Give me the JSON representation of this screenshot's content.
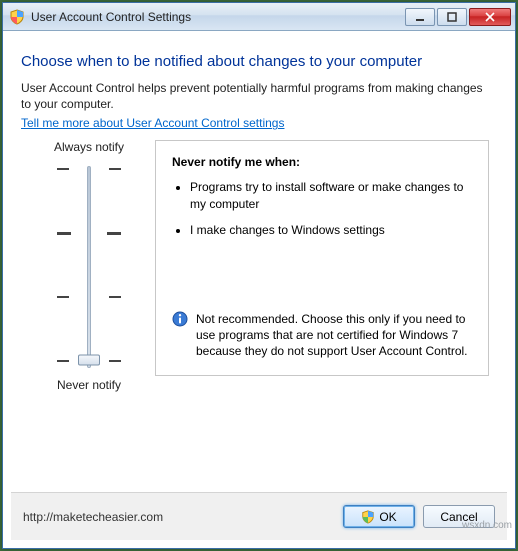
{
  "window": {
    "title": "User Account Control Settings"
  },
  "heading": "Choose when to be notified about changes to your computer",
  "description": "User Account Control helps prevent potentially harmful programs from making changes to your computer.",
  "link": "Tell me more about User Account Control settings",
  "slider": {
    "top_label": "Always notify",
    "bottom_label": "Never notify"
  },
  "panel": {
    "title": "Never notify me when:",
    "items": [
      "Programs try to install software or make changes to my computer",
      "I make changes to Windows settings"
    ],
    "recommendation": "Not recommended. Choose this only if you need to use programs that are not certified for Windows 7 because they do not support User Account Control."
  },
  "buttons": {
    "ok": "OK",
    "cancel": "Cancel"
  },
  "footer_url": "http://maketecheasier.com",
  "watermark": "wsxdn.com"
}
